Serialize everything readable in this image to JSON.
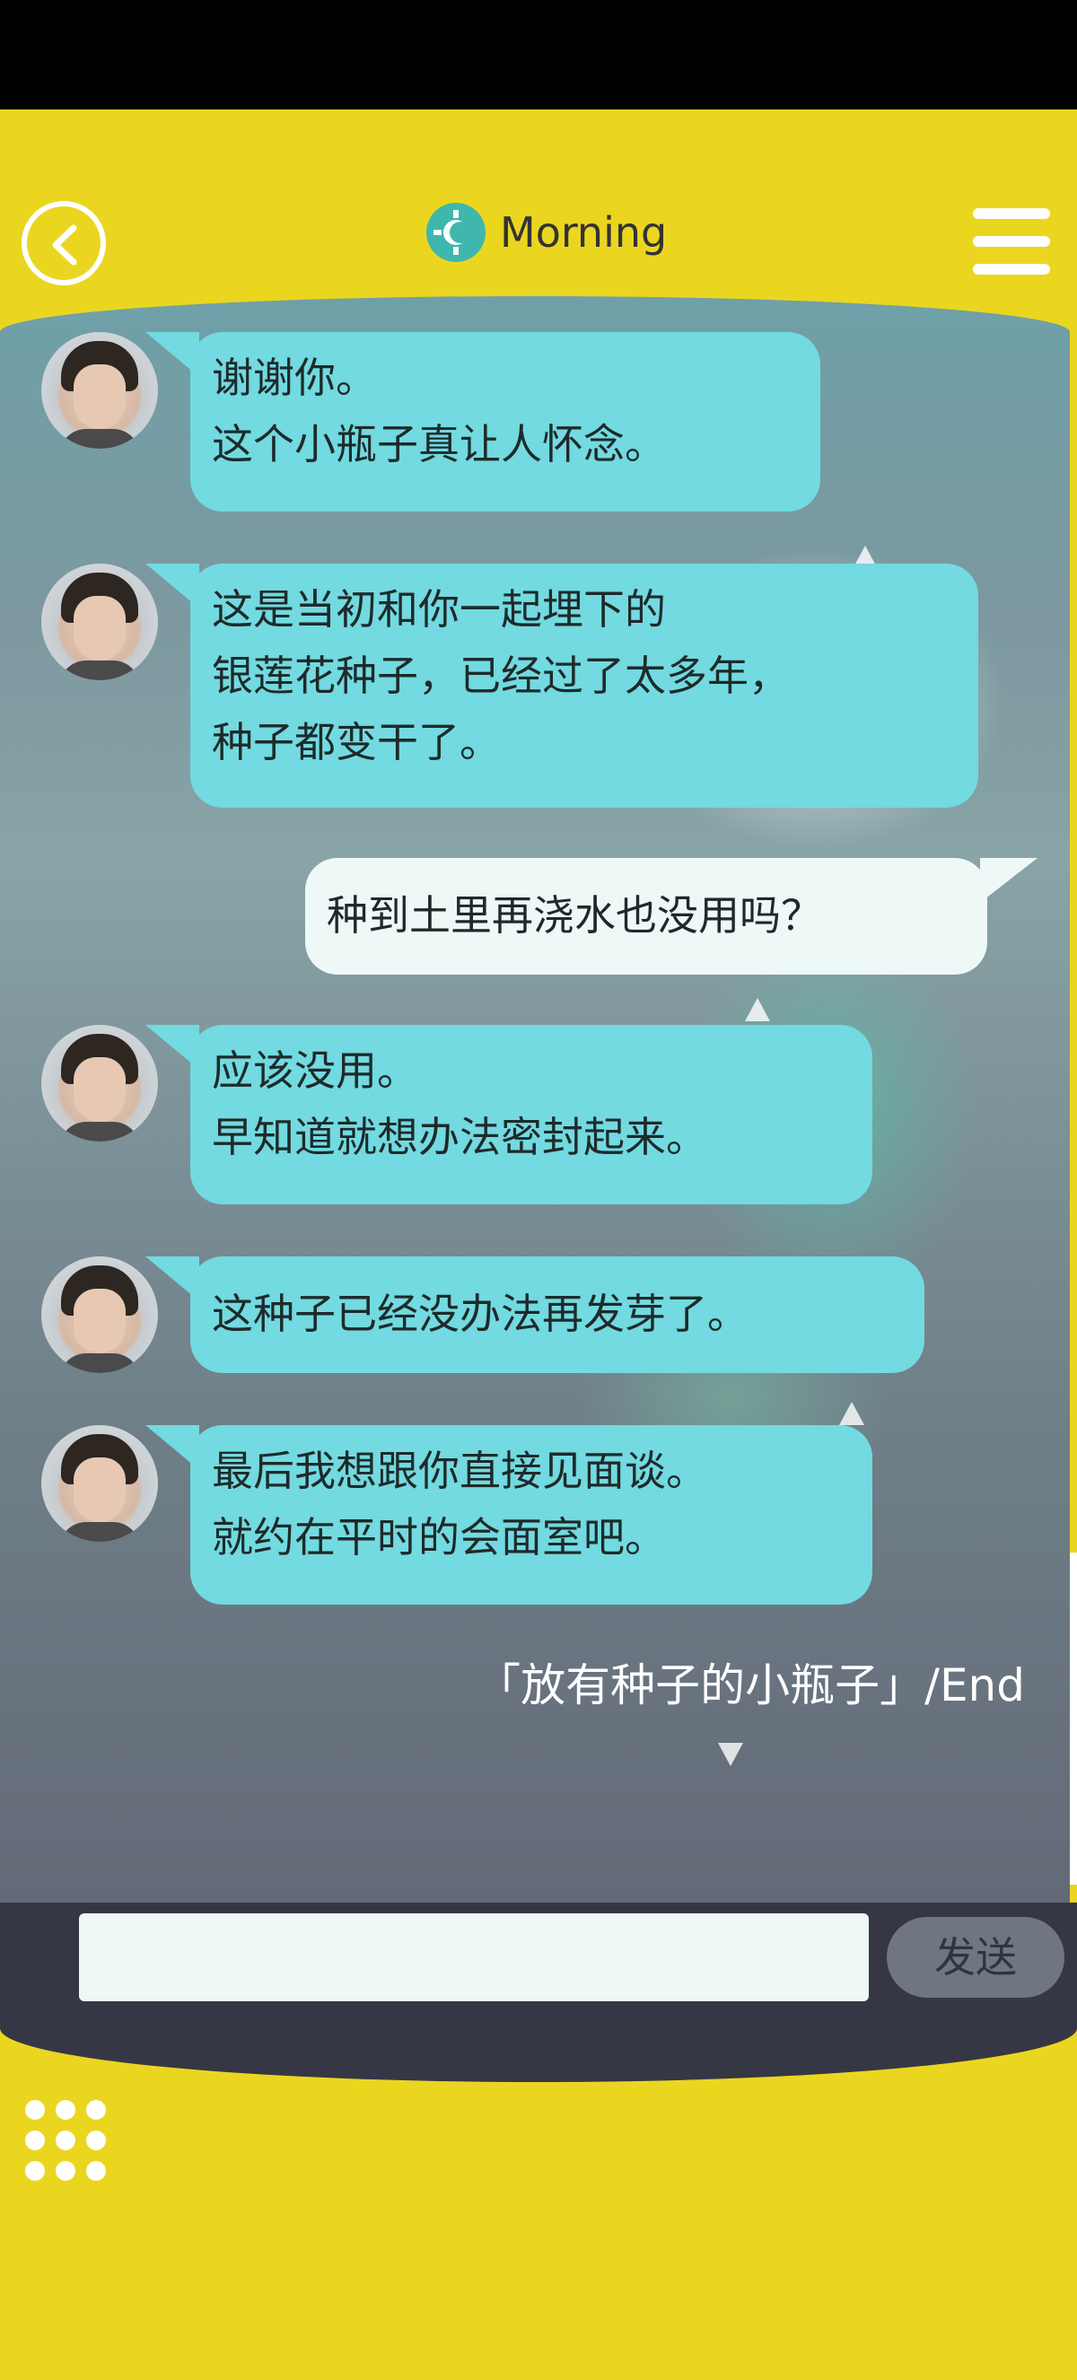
{
  "header": {
    "time_label": "Morning",
    "back_icon": "chevron-left-icon",
    "menu_icon": "hamburger-menu-icon",
    "time_icon": "sun-gear-icon"
  },
  "messages": [
    {
      "side": "left",
      "text": "谢谢你。\n这个小瓶子真让人怀念。"
    },
    {
      "side": "left",
      "text": "这是当初和你一起埋下的\n银莲花种子，已经过了太多年，\n种子都变干了。"
    },
    {
      "side": "right",
      "text": "种到土里再浇水也没用吗？"
    },
    {
      "side": "left",
      "text": "应该没用。\n早知道就想办法密封起来。"
    },
    {
      "side": "left",
      "text": "这种子已经没办法再发芽了。"
    },
    {
      "side": "left",
      "text": "最后我想跟你直接见面谈。\n就约在平时的会面室吧。"
    }
  ],
  "end_label": "「放有种子的小瓶子」/End",
  "input": {
    "value": "",
    "placeholder": ""
  },
  "send_label": "发送",
  "colors": {
    "app_background": "#ebd61f",
    "bubble_left": "#72dae0",
    "bubble_right": "#eef8f7",
    "input_bar": "#363744"
  }
}
